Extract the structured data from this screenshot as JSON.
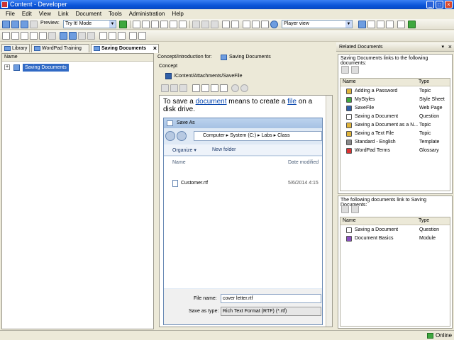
{
  "window": {
    "title": "Content - Developer",
    "controls": [
      "_",
      "□",
      "×"
    ]
  },
  "menu": [
    "File",
    "Edit",
    "View",
    "Link",
    "Document",
    "Tools",
    "Administration",
    "Help"
  ],
  "toolbar": {
    "preview_label": "Preview:",
    "preview_mode": "Try It! Mode",
    "view_mode": "Player view"
  },
  "tabs": [
    {
      "label": "Library"
    },
    {
      "label": "WordPad Training"
    },
    {
      "label": "Saving Documents",
      "close": "×"
    }
  ],
  "tree": {
    "header": "Name",
    "expander": "+",
    "item": "Saving Documents"
  },
  "concept": {
    "intro_label": "Concept/Introduction for:",
    "doc_name": "Saving Documents",
    "section": "Concept",
    "path": "/Content/Attachments/SaveFile",
    "text_pre": "To save a ",
    "link1": "document",
    "text_mid": " means to create a ",
    "link2": "file",
    "text_post": " on a disk drive."
  },
  "save_dialog": {
    "title": "Save As",
    "breadcrumb": [
      "Computer",
      "System (C:)",
      "Labs",
      "Class"
    ],
    "organize": "Organize ▾",
    "new_folder": "New folder",
    "col_name": "Name",
    "col_date": "Date modified",
    "file_name": "Customer.rtf",
    "file_date": "5/6/2014 4:15",
    "file_name_label": "File name:",
    "file_name_value": "cover letter.rtf",
    "type_label": "Save as type:",
    "type_value": "Rich Text Format (RTF) (*.rtf)"
  },
  "related": {
    "title": "Related Documents",
    "links_to": "Saving Documents links to the following documents:",
    "col_name": "Name",
    "col_type": "Type",
    "items": [
      {
        "name": "Adding a Password",
        "type": "Topic",
        "color": "#e0b43a"
      },
      {
        "name": "MyStyles",
        "type": "Style Sheet",
        "color": "#3fa83f"
      },
      {
        "name": "SaveFile",
        "type": "Web Page",
        "color": "#2f5fa8"
      },
      {
        "name": "Saving a Document",
        "type": "Question",
        "color": "#ffffff"
      },
      {
        "name": "Saving a Document as a N...",
        "type": "Topic",
        "color": "#e0b43a"
      },
      {
        "name": "Saving a Text File",
        "type": "Topic",
        "color": "#e0b43a"
      },
      {
        "name": "Standard - English",
        "type": "Template",
        "color": "#8a8a8a"
      },
      {
        "name": "WordPad Terms",
        "type": "Glossary",
        "color": "#d33"
      }
    ],
    "linked_by": "The following documents link to Saving Documents:",
    "items2": [
      {
        "name": "Saving a Document",
        "type": "Question",
        "color": "#ffffff"
      },
      {
        "name": "Document Basics",
        "type": "Module",
        "color": "#8a4fc0"
      }
    ]
  },
  "status": {
    "online": "Online"
  }
}
